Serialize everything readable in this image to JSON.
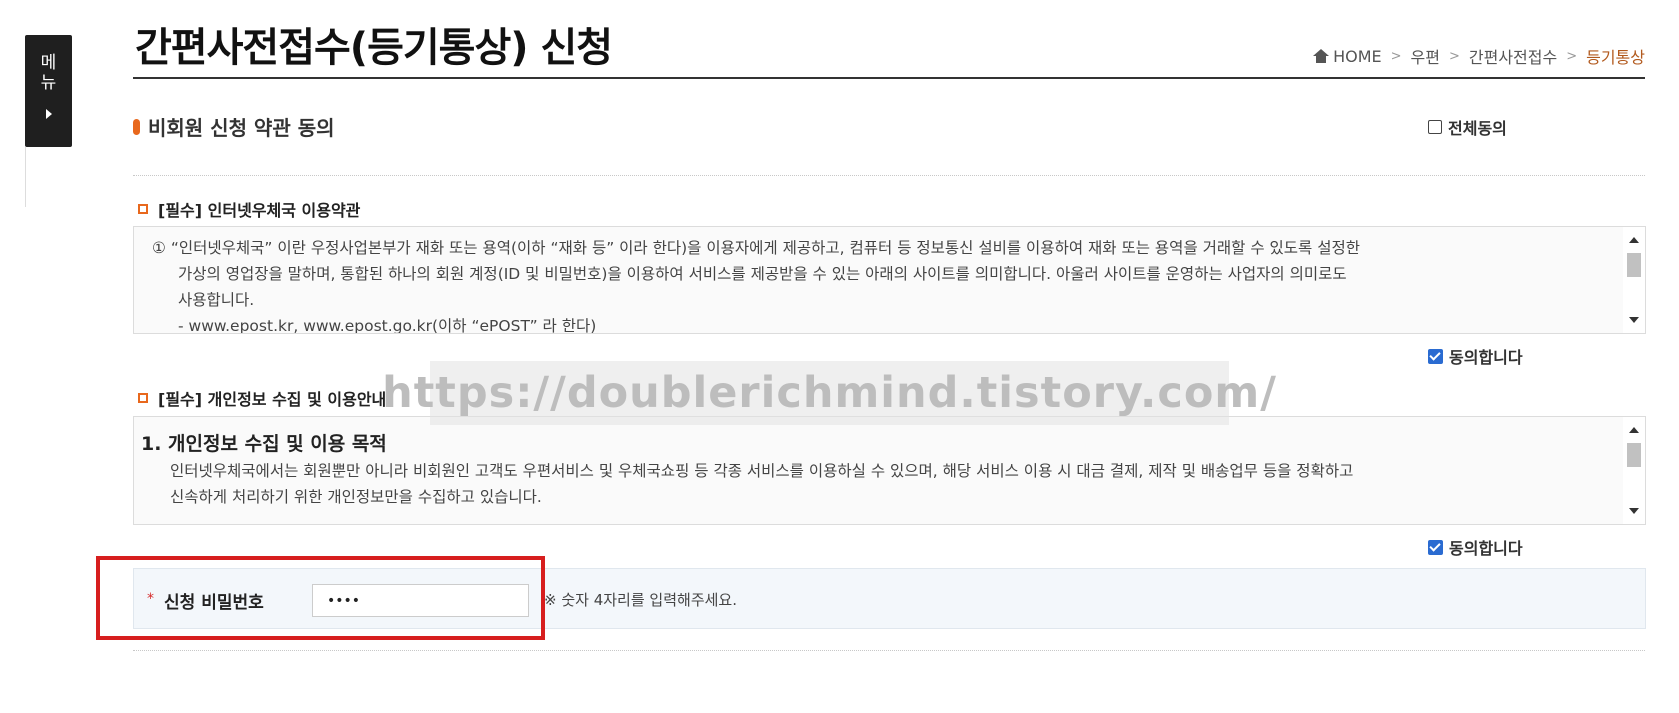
{
  "side_menu": {
    "label": "메뉴"
  },
  "header": {
    "title": "간편사전접수(등기통상) 신청",
    "breadcrumb": [
      "HOME",
      "우편",
      "간편사전접수",
      "등기통상"
    ]
  },
  "section": {
    "title": "비회원 신청 약관 동의",
    "agree_all_label": "전체동의",
    "agree_all_checked": false
  },
  "terms1": {
    "heading": "[필수] 인터넷우체국 이용약관",
    "lines": [
      "① “인터넷우체국” 이란 우정사업본부가 재화 또는 용역(이하 “재화 등” 이라 한다)을 이용자에게 제공하고, 컴퓨터 등 정보통신 설비를 이용하여 재화 또는 용역을 거래할 수 있도록 설정한",
      "가상의 영업장을 말하며, 통합된 하나의 회원 계정(ID 및 비밀번호)을 이용하여 서비스를 제공받을 수 있는 아래의 사이트를 의미합니다. 아울러 사이트를 운영하는 사업자의 의미로도",
      "사용합니다.",
      "- www.epost.kr, www.epost.go.kr(이하 “ePOST” 라 한다)"
    ],
    "agree_label": "동의합니다",
    "agree_checked": true
  },
  "terms2": {
    "heading": "[필수] 개인정보 수집 및 이용안내",
    "subheading": "1. 개인정보 수집 및 이용 목적",
    "lines": [
      "인터넷우체국에서는 회원뿐만 아니라 비회원인 고객도 우편서비스 및 우체국쇼핑 등 각종 서비스를 이용하실 수 있으며, 해당 서비스 이용 시 대금 결제, 제작 및 배송업무 등을 정확하고",
      "신속하게 처리하기 위한 개인정보만을 수집하고 있습니다."
    ],
    "agree_label": "동의합니다",
    "agree_checked": true
  },
  "watermark": "https://doublerichmind.tistory.com/",
  "password": {
    "required_mark": "*",
    "label": "신청 비밀번호",
    "value": "••••",
    "hint": "※ 숫자 4자리를 입력해주세요."
  },
  "colors": {
    "accent": "#e8681d",
    "breadcrumb_current": "#b25a1e",
    "checkbox": "#2a6bd1",
    "highlight": "#d71e1e"
  }
}
